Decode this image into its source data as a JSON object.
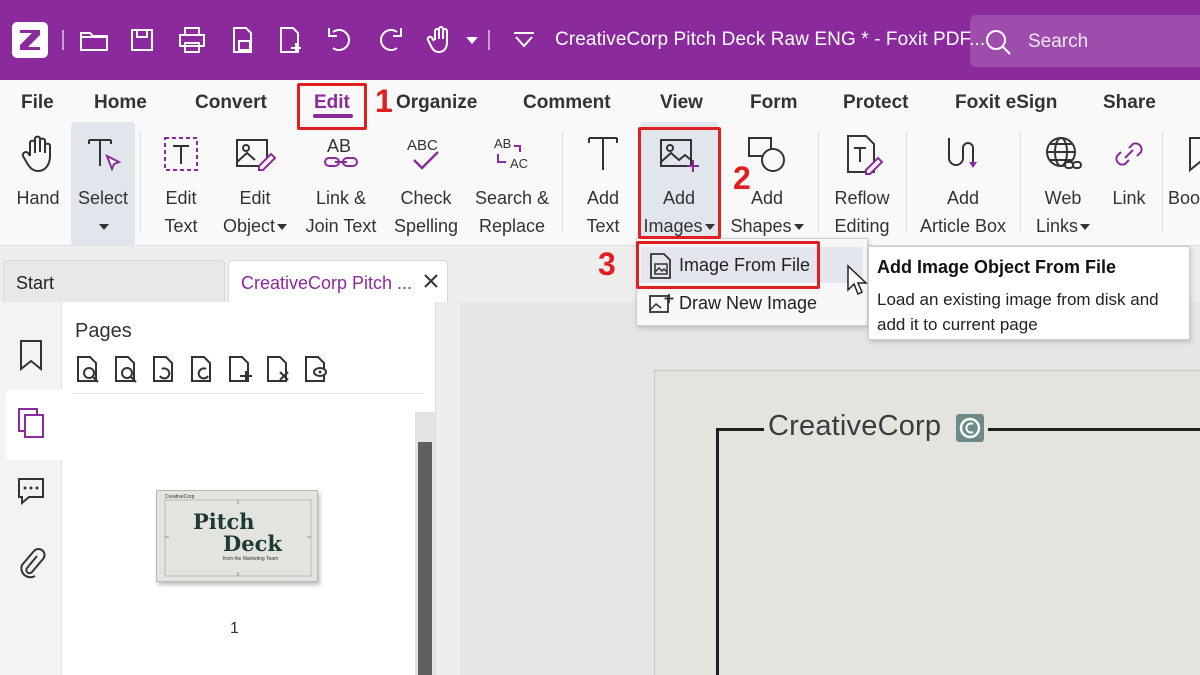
{
  "app": {
    "title": "CreativeCorp Pitch Deck Raw ENG * - Foxit PDF...",
    "search_placeholder": "Search",
    "accent_color": "#8b2a9c"
  },
  "quick_access": [
    "open-folder-icon",
    "save-icon",
    "print-icon",
    "scan-icon",
    "new-file-icon",
    "undo-icon",
    "redo-icon",
    "pan-hand-icon",
    "dropdown-caret-icon",
    "customize-icon"
  ],
  "menu": {
    "tabs": [
      {
        "label": "File"
      },
      {
        "label": "Home"
      },
      {
        "label": "Convert"
      },
      {
        "label": "Edit",
        "active": true
      },
      {
        "label": "Organize"
      },
      {
        "label": "Comment"
      },
      {
        "label": "View"
      },
      {
        "label": "Form"
      },
      {
        "label": "Protect"
      },
      {
        "label": "Foxit eSign"
      },
      {
        "label": "Share"
      }
    ]
  },
  "ribbon": {
    "hand": "Hand",
    "select": "Select",
    "edit_text": [
      "Edit",
      "Text"
    ],
    "edit_object": [
      "Edit",
      "Object"
    ],
    "link_join": [
      "Link &",
      "Join Text"
    ],
    "check_spelling": [
      "Check",
      "Spelling"
    ],
    "search_replace": [
      "Search &",
      "Replace"
    ],
    "add_text": [
      "Add",
      "Text"
    ],
    "add_images": [
      "Add",
      "Images"
    ],
    "add_shapes": [
      "Add",
      "Shapes"
    ],
    "reflow": [
      "Reflow",
      "Editing"
    ],
    "article_box": [
      "Add",
      "Article Box"
    ],
    "web_links": [
      "Web",
      "Links"
    ],
    "link": "Link",
    "bookmark_partial": "Boo"
  },
  "annotations": {
    "step1": "1",
    "step2": "2",
    "step3": "3"
  },
  "dropdown": {
    "items": [
      "Image From File",
      "Draw New Image"
    ]
  },
  "tooltip": {
    "title": "Add Image Object From File",
    "body": "Load an existing image from disk and add it to current page"
  },
  "doc_tabs": {
    "start": "Start",
    "active": "CreativeCorp Pitch ..."
  },
  "sidebar": {
    "pages_title": "Pages",
    "page_number": "1",
    "thumbnail": {
      "brand": "CreativeCorp",
      "title_line1": "Pitch",
      "title_line2": "Deck",
      "subtitle": "from the Marketing Team"
    }
  },
  "document": {
    "brand": "CreativeCorp"
  }
}
